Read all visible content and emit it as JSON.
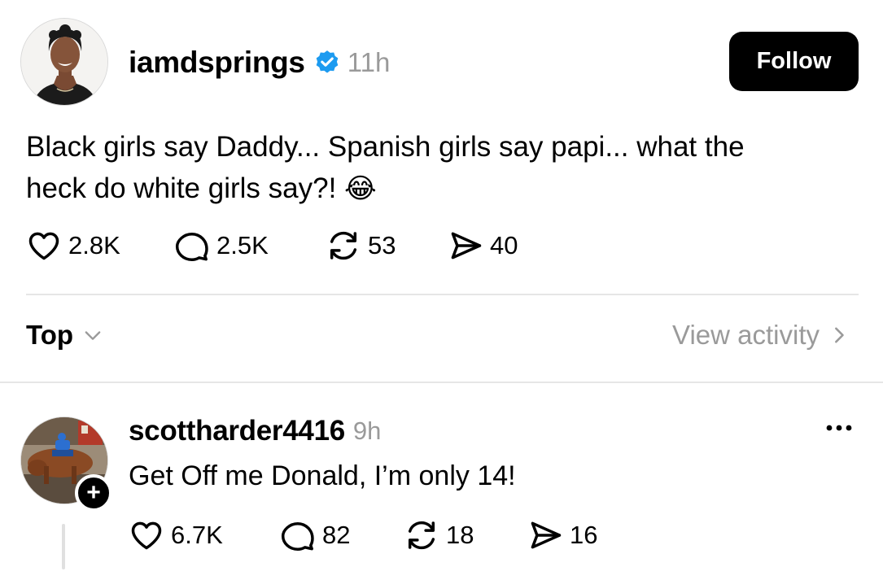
{
  "post": {
    "username": "iamdsprings",
    "time": "11h",
    "follow_label": "Follow",
    "text_line1": "Black girls say Daddy... Spanish girls say papi... what the",
    "text_line2": "heck do white girls say?!",
    "emoji": "😂",
    "likes": "2.8K",
    "replies": "2.5K",
    "reposts": "53",
    "shares": "40"
  },
  "sort": {
    "label": "Top",
    "view_activity_label": "View activity"
  },
  "reply": {
    "username": "scottharder4416",
    "time": "9h",
    "text": "Get Off me Donald, I’m only 14!",
    "likes": "6.7K",
    "replies": "82",
    "reposts": "18",
    "shares": "16",
    "follow_badge": "+"
  },
  "colors": {
    "verified": "#1d9bf0",
    "muted_text": "#9a9a9a",
    "divider": "#e6e6e6"
  },
  "icons": [
    "heart-icon",
    "comment-icon",
    "repost-icon",
    "share-icon",
    "verified-badge-icon",
    "chevron-down-icon",
    "chevron-right-icon",
    "more-icon"
  ]
}
